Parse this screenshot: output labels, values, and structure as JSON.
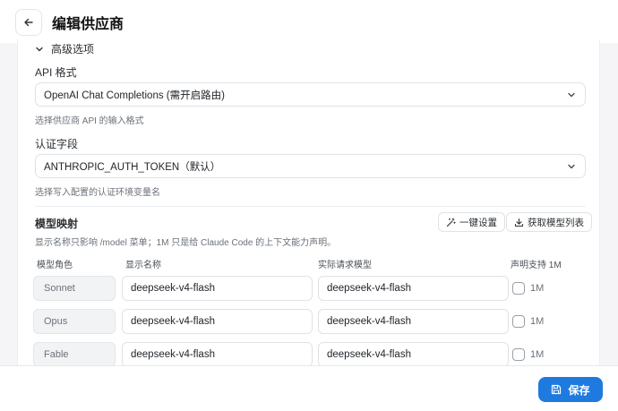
{
  "header": {
    "title": "编辑供应商"
  },
  "advanced": {
    "toggle_label": "高级选项"
  },
  "api_format": {
    "label": "API 格式",
    "value": "OpenAI Chat Completions (需开启路由)",
    "hint": "选择供应商 API 的输入格式"
  },
  "auth_field": {
    "label": "认证字段",
    "value": "ANTHROPIC_AUTH_TOKEN（默认）",
    "hint": "选择写入配置的认证环境变量名"
  },
  "model_mapping": {
    "title": "模型映射",
    "hint": "显示名称只影响 /model 菜单；1M 只是给 Claude Code 的上下文能力声明。",
    "one_click_label": "一键设置",
    "fetch_models_label": "获取模型列表",
    "columns": [
      "模型角色",
      "显示名称",
      "实际请求模型",
      "声明支持 1M"
    ],
    "rows": [
      {
        "role": "Sonnet",
        "display_name": "deepseek-v4-flash",
        "request_model": "deepseek-v4-flash",
        "one_m_label": "1M",
        "one_m_checked": false
      },
      {
        "role": "Opus",
        "display_name": "deepseek-v4-flash",
        "request_model": "deepseek-v4-flash",
        "one_m_label": "1M",
        "one_m_checked": false
      },
      {
        "role": "Fable",
        "display_name": "deepseek-v4-flash",
        "request_model": "deepseek-v4-flash",
        "one_m_label": "1M",
        "one_m_checked": false
      }
    ]
  },
  "footer": {
    "save_label": "保存"
  },
  "colors": {
    "accent": "#1f7ae0",
    "background": "#f5f5f7",
    "border": "#dfe2e6"
  },
  "icons": {
    "back": "arrow-left-icon",
    "toggle": "chevron-down-icon",
    "select": "chevron-down-icon",
    "one_click": "magic-wand-icon",
    "fetch": "download-icon",
    "save": "save-icon"
  }
}
